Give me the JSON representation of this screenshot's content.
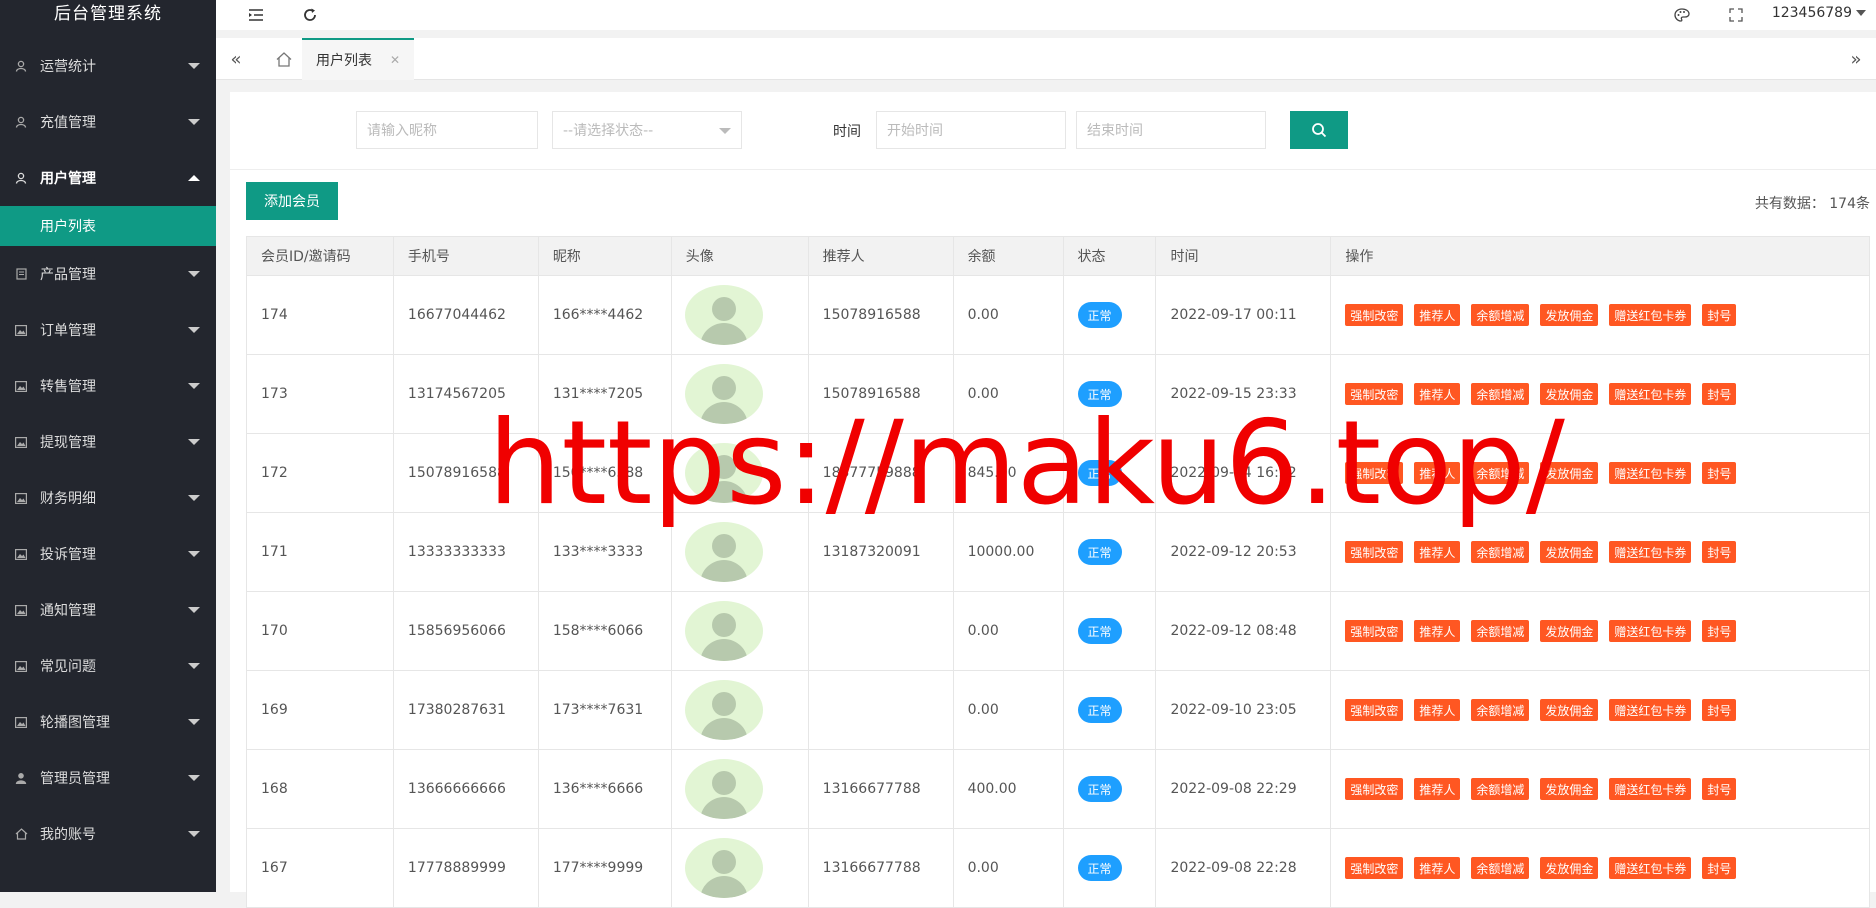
{
  "app": {
    "title": "后台管理系统",
    "user": "123456789"
  },
  "sidebar": {
    "items": [
      {
        "label": "运营统计",
        "icon": "user-icon"
      },
      {
        "label": "充值管理",
        "icon": "user-icon"
      },
      {
        "label": "用户管理",
        "icon": "user-icon",
        "open": true,
        "children": [
          {
            "label": "用户列表"
          }
        ]
      },
      {
        "label": "产品管理",
        "icon": "file-icon"
      },
      {
        "label": "订单管理",
        "icon": "image-icon"
      },
      {
        "label": "转售管理",
        "icon": "image-icon"
      },
      {
        "label": "提现管理",
        "icon": "image-icon"
      },
      {
        "label": "财务明细",
        "icon": "image-icon"
      },
      {
        "label": "投诉管理",
        "icon": "image-icon"
      },
      {
        "label": "通知管理",
        "icon": "image-icon"
      },
      {
        "label": "常见问题",
        "icon": "image-icon"
      },
      {
        "label": "轮播图管理",
        "icon": "image-icon"
      },
      {
        "label": "管理员管理",
        "icon": "person-icon"
      },
      {
        "label": "我的账号",
        "icon": "home-icon"
      }
    ]
  },
  "tabs": [
    {
      "label": "用户列表"
    }
  ],
  "filter": {
    "nickname_placeholder": "请输入昵称",
    "status_placeholder": "--请选择状态--",
    "time_label": "时间",
    "start_placeholder": "开始时间",
    "end_placeholder": "结束时间"
  },
  "toolbar": {
    "add_label": "添加会员",
    "total": "共有数据：  174条"
  },
  "table": {
    "headers": [
      "会员ID/邀请码",
      "手机号",
      "昵称",
      "头像",
      "推荐人",
      "余额",
      "状态",
      "时间",
      "操作"
    ],
    "actions": [
      "强制改密",
      "推荐人",
      "余额增减",
      "发放佣金",
      "赠送红包卡券",
      "封号"
    ],
    "rows": [
      {
        "id": "174",
        "phone": "16677044462",
        "nick": "166****4462",
        "ref": "15078916588",
        "balance": "0.00",
        "status": "正常",
        "time": "2022-09-17 00:11"
      },
      {
        "id": "173",
        "phone": "13174567205",
        "nick": "131****7205",
        "ref": "15078916588",
        "balance": "0.00",
        "status": "正常",
        "time": "2022-09-15 23:33"
      },
      {
        "id": "172",
        "phone": "15078916588",
        "nick": "150****6588",
        "ref": "18377759888",
        "balance": "845.00",
        "status": "正常",
        "time": "2022-09-14 16:32"
      },
      {
        "id": "171",
        "phone": "13333333333",
        "nick": "133****3333",
        "ref": "13187320091",
        "balance": "10000.00",
        "status": "正常",
        "time": "2022-09-12 20:53"
      },
      {
        "id": "170",
        "phone": "15856956066",
        "nick": "158****6066",
        "ref": "",
        "balance": "0.00",
        "status": "正常",
        "time": "2022-09-12 08:48"
      },
      {
        "id": "169",
        "phone": "17380287631",
        "nick": "173****7631",
        "ref": "",
        "balance": "0.00",
        "status": "正常",
        "time": "2022-09-10 23:05"
      },
      {
        "id": "168",
        "phone": "13666666666",
        "nick": "136****6666",
        "ref": "13166677788",
        "balance": "400.00",
        "status": "正常",
        "time": "2022-09-08 22:29"
      },
      {
        "id": "167",
        "phone": "17778889999",
        "nick": "177****9999",
        "ref": "13166677788",
        "balance": "0.00",
        "status": "正常",
        "time": "2022-09-08 22:28"
      }
    ]
  },
  "watermark": "https://maku6.top/",
  "colors": {
    "sidebar": "#23262e",
    "accent": "#0f9a85",
    "status": "#1e9fff",
    "action": "#ff5722"
  }
}
